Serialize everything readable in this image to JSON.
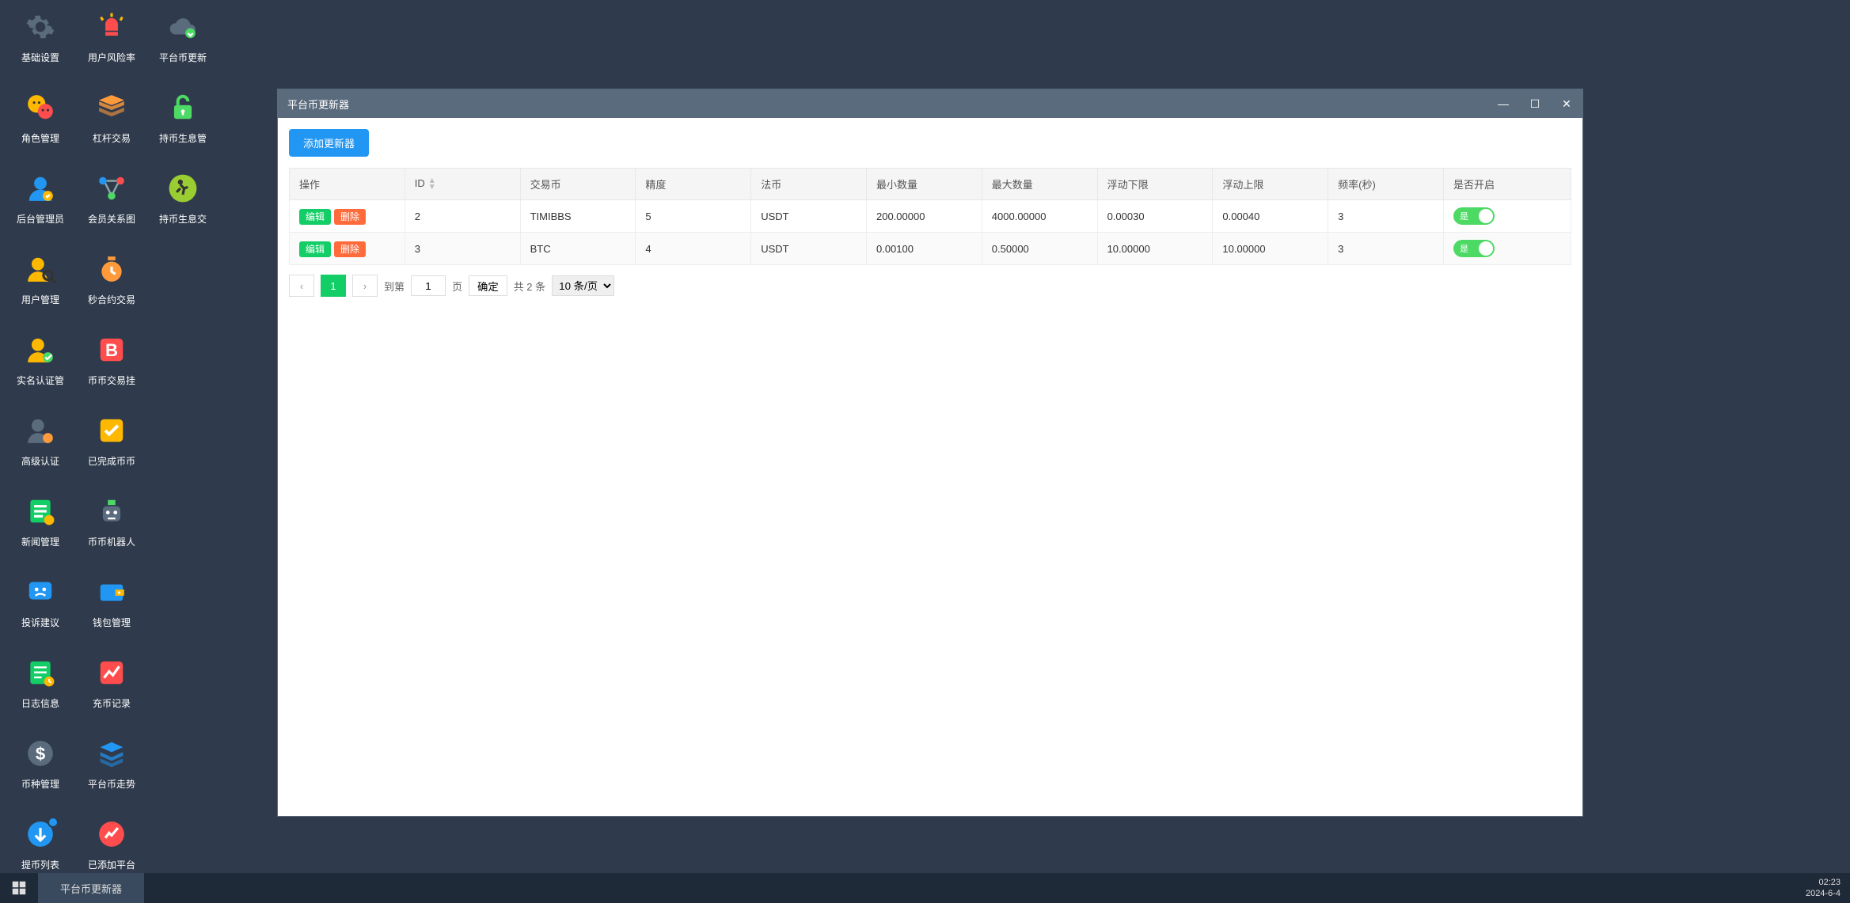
{
  "desktop": [
    [
      {
        "label": "基础设置",
        "icon": "gear",
        "color": "#5a6b7d"
      },
      {
        "label": "用户风险率",
        "icon": "alert",
        "color": "#ff4d4d"
      },
      {
        "label": "平台币更新",
        "icon": "cloud",
        "color": "#5a6b7d"
      }
    ],
    [
      {
        "label": "角色管理",
        "icon": "faces",
        "color": "#ffb800"
      },
      {
        "label": "杠杆交易",
        "icon": "stack",
        "color": "#ff9a3b"
      },
      {
        "label": "持币生息管",
        "icon": "lock",
        "color": "#4cd964"
      }
    ],
    [
      {
        "label": "后台管理员",
        "icon": "admin",
        "color": "#2196f3"
      },
      {
        "label": "会员关系图",
        "icon": "graph",
        "color": "#2196f3"
      },
      {
        "label": "持币生息交",
        "icon": "run",
        "color": "#9acd32"
      }
    ],
    [
      {
        "label": "用户管理",
        "icon": "usersearch",
        "color": "#ffb800"
      },
      {
        "label": "秒合约交易",
        "icon": "timer",
        "color": "#ff9a3b"
      }
    ],
    [
      {
        "label": "实名认证管",
        "icon": "usercheck",
        "color": "#ffb800"
      },
      {
        "label": "币币交易挂",
        "icon": "bitcoin",
        "color": "#ff4d4d"
      }
    ],
    [
      {
        "label": "高级认证",
        "icon": "usershield",
        "color": "#5a6b7d"
      },
      {
        "label": "已完成币币",
        "icon": "check",
        "color": "#ffb800"
      }
    ],
    [
      {
        "label": "新闻管理",
        "icon": "news",
        "color": "#13ce66"
      },
      {
        "label": "币币机器人",
        "icon": "robot",
        "color": "#5a6b7d"
      }
    ],
    [
      {
        "label": "投诉建议",
        "icon": "complaint",
        "color": "#2196f3"
      },
      {
        "label": "钱包管理",
        "icon": "wallet",
        "color": "#2196f3"
      }
    ],
    [
      {
        "label": "日志信息",
        "icon": "log",
        "color": "#13ce66"
      },
      {
        "label": "充币记录",
        "icon": "chart",
        "color": "#ff4d4d"
      }
    ],
    [
      {
        "label": "币种管理",
        "icon": "coin",
        "color": "#5a6b7d"
      },
      {
        "label": "平台币走势",
        "icon": "layers",
        "color": "#2196f3"
      }
    ],
    [
      {
        "label": "提币列表",
        "icon": "withdraw",
        "color": "#2196f3",
        "badge": true
      },
      {
        "label": "已添加平台",
        "icon": "trend",
        "color": "#ff4d4d"
      }
    ]
  ],
  "window": {
    "title": "平台币更新器",
    "add_button": "添加更新器",
    "columns": [
      "操作",
      "ID",
      "交易币",
      "精度",
      "法币",
      "最小数量",
      "最大数量",
      "浮动下限",
      "浮动上限",
      "频率(秒)",
      "是否开启"
    ],
    "edit_label": "编辑",
    "delete_label": "删除",
    "switch_label": "是",
    "rows": [
      {
        "id": "2",
        "coin": "TIMIBBS",
        "precision": "5",
        "fiat": "USDT",
        "min": "200.00000",
        "max": "4000.00000",
        "low": "0.00030",
        "high": "0.00040",
        "freq": "3"
      },
      {
        "id": "3",
        "coin": "BTC",
        "precision": "4",
        "fiat": "USDT",
        "min": "0.00100",
        "max": "0.50000",
        "low": "10.00000",
        "high": "10.00000",
        "freq": "3"
      }
    ]
  },
  "pager": {
    "current": "1",
    "goto_prefix": "到第",
    "page_input": "1",
    "goto_suffix": "页",
    "confirm": "确定",
    "total": "共 2 条",
    "per_page": "10 条/页"
  },
  "taskbar": {
    "task": "平台币更新器",
    "time": "02:23",
    "date": "2024-6-4"
  }
}
